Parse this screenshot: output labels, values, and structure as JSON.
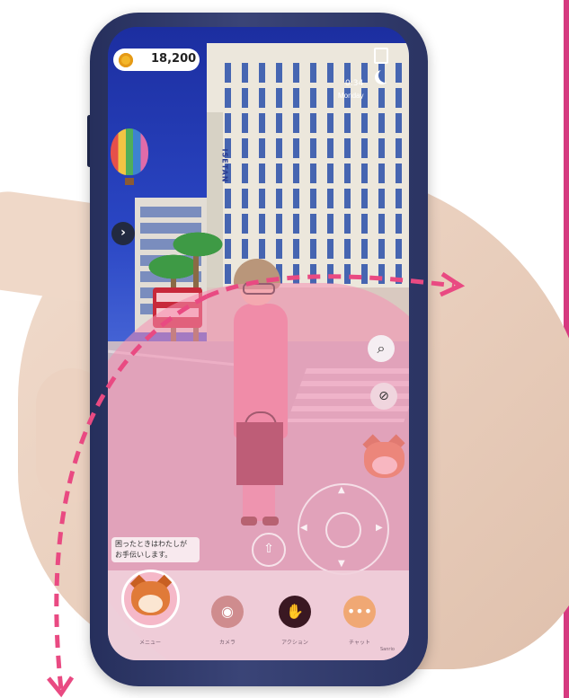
{
  "status": {
    "coins": "18,200",
    "clock": "0:34",
    "day": "Monday"
  },
  "scene": {
    "building_sign": "ISETAN"
  },
  "help_bubble": {
    "text": "困ったときはわたしが\nお手伝いします。"
  },
  "nav": {
    "menu_label": "メニュー",
    "camera_label": "カメラ",
    "action_label": "アクション",
    "chat_label": "チャット"
  },
  "copyright": "Sanrio",
  "colors": {
    "accent": "#d63a80",
    "pink_overlay": "#f68fb2",
    "dashed_arrow": "#e94a82",
    "phone_frame": "#2f3866"
  },
  "icons": {
    "coin": "coin-icon",
    "search": "search-icon",
    "mute": "microphone-muted-icon",
    "side": "chevron-right-icon",
    "camera": "camera-icon",
    "action": "pose-icon",
    "chat": "chat-bubble-icon",
    "jump": "arrow-up-icon"
  }
}
